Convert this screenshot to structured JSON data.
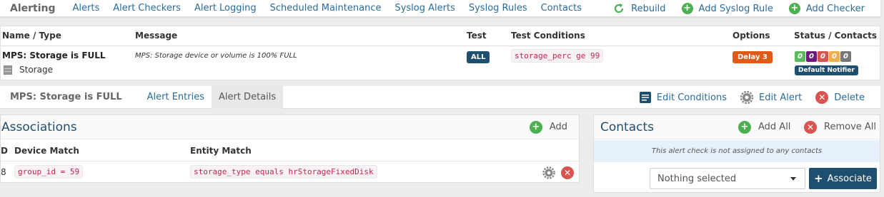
{
  "navbar": {
    "brand": "Alerting",
    "links": [
      "Alerts",
      "Alert Checkers",
      "Alert Logging",
      "Scheduled Maintenance",
      "Syslog Alerts",
      "Syslog Rules",
      "Contacts"
    ],
    "actions": {
      "rebuild": "Rebuild",
      "add_syslog_rule": "Add Syslog Rule",
      "add_checker": "Add Checker"
    }
  },
  "alert_table": {
    "headers": {
      "name": "Name / Type",
      "message": "Message",
      "test": "Test",
      "conditions": "Test Conditions",
      "options": "Options",
      "status": "Status / Contacts"
    },
    "row": {
      "name": "MPS: Storage is FULL",
      "type": "Storage",
      "message": "MPS: Storage device or volume is 100% FULL",
      "test": "ALL",
      "condition": "storage_perc ge 99",
      "delay": "Delay 3",
      "status_counts": [
        {
          "value": "0",
          "color": "#5cb85c"
        },
        {
          "value": "0",
          "color": "#6a1b7a"
        },
        {
          "value": "0",
          "color": "#d9534f"
        },
        {
          "value": "0",
          "color": "#f0ad4e"
        },
        {
          "value": "0",
          "color": "#777777"
        }
      ],
      "notifier": "Default Notifier"
    }
  },
  "subnav": {
    "title": "MPS: Storage is FULL",
    "tabs": [
      "Alert Entries",
      "Alert Details"
    ],
    "actions": {
      "edit_conditions": "Edit Conditions",
      "edit_alert": "Edit Alert",
      "delete": "Delete"
    }
  },
  "associations": {
    "title": "Associations",
    "add_label": "Add",
    "headers": {
      "id": "D",
      "device": "Device Match",
      "entity": "Entity Match"
    },
    "row": {
      "id": "8",
      "device": "group_id = 59",
      "entity": "storage_type equals hrStorageFixedDisk"
    }
  },
  "contacts": {
    "title": "Contacts",
    "add_all": "Add All",
    "remove_all": "Remove All",
    "empty_message": "This alert check is not assigned to any contacts",
    "select_value": "Nothing selected",
    "associate_label": "Associate"
  }
}
